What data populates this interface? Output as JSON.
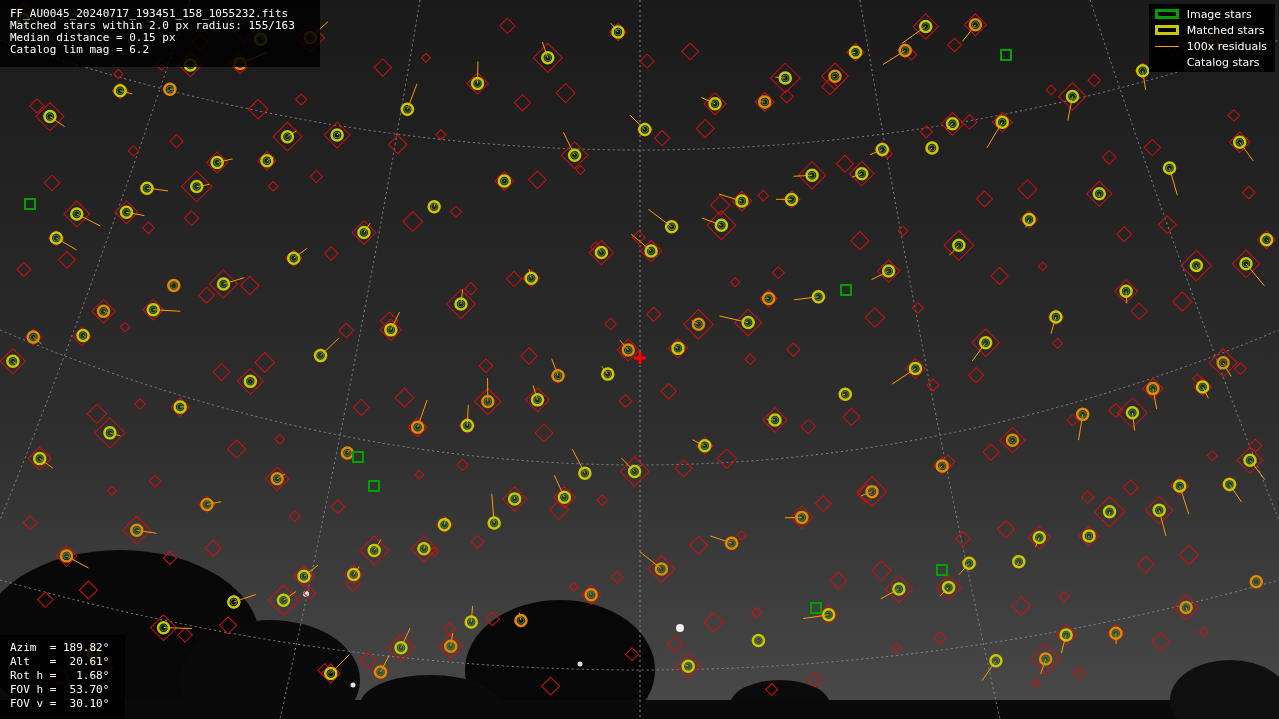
{
  "info": {
    "lines": [
      "FF_AU0045_20240717_193451_158_1055232.fits",
      "Matched stars within 2.0 px radius: 155/163",
      "Median distance = 0.15 px",
      "Catalog lim mag = 6.2"
    ]
  },
  "legend": [
    {
      "kind": "box",
      "color": "#00a000",
      "label": "Image stars"
    },
    {
      "kind": "box",
      "color": "#c8c800",
      "label": "Matched stars"
    },
    {
      "kind": "line",
      "color": "#ff9900",
      "label": "100x residuals"
    },
    {
      "kind": "none",
      "label": "Catalog stars"
    }
  ],
  "pointing": {
    "lines": [
      "Azim  = 189.82°",
      "Alt   =  20.61°",
      "Rot h =   1.68°",
      "FOV h =  53.70°",
      "FOV v =  30.10°"
    ]
  }
}
